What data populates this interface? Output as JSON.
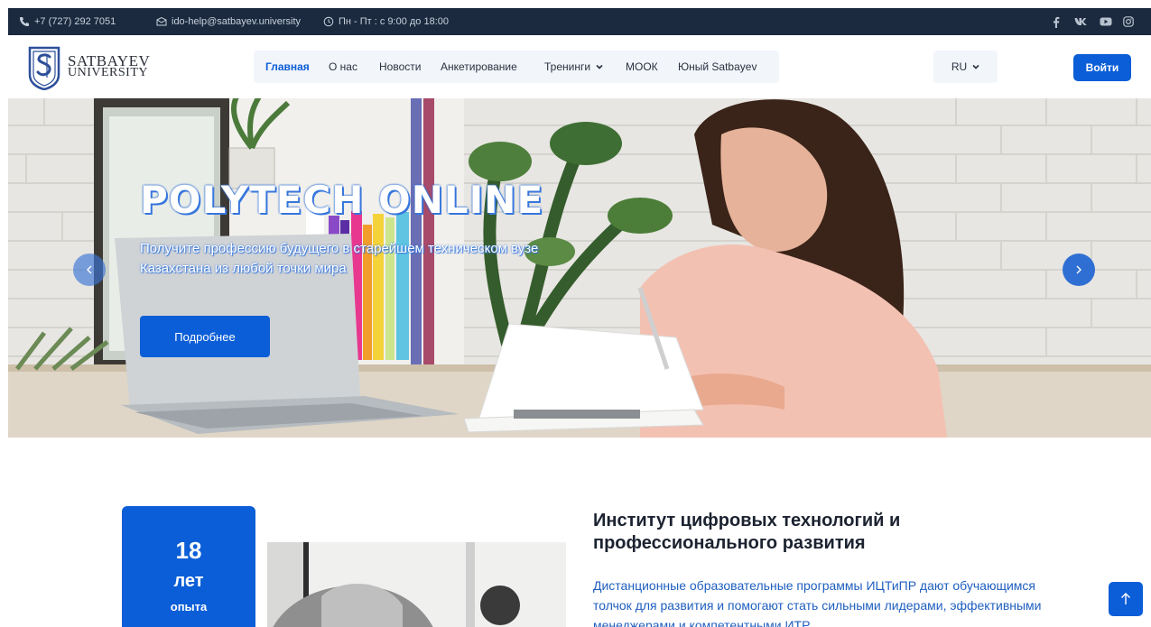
{
  "topbar": {
    "phone": "+7 (727) 292 7051",
    "email": "ido-help@satbayev.university",
    "hours": "Пн - Пт : с 9:00 до 18:00",
    "socials": [
      "facebook-icon",
      "vk-icon",
      "youtube-icon",
      "instagram-icon"
    ]
  },
  "logo": {
    "line1": "SATBAYEV",
    "line2": "UNIVERSITY"
  },
  "nav": {
    "items": [
      {
        "label": "Главная",
        "active": true
      },
      {
        "label": "О нас"
      },
      {
        "label": "Новости"
      },
      {
        "label": "Анкетирование"
      },
      {
        "label": "Тренинги",
        "dropdown": true
      },
      {
        "label": "МООК"
      },
      {
        "label": "Юный Satbayev"
      }
    ]
  },
  "lang": {
    "label": "RU"
  },
  "login": {
    "label": "Войти"
  },
  "hero": {
    "title": "POLYTECH ONLINE",
    "subtitle": "Получите профессию будущего в старейшем техническом вузе Казахстана из любой точки мира",
    "button": "Подробнее"
  },
  "stats": {
    "number": "18",
    "unit": "лет",
    "label": "опыта"
  },
  "about": {
    "title": "Институт цифровых технологий и профессионального развития",
    "text": "Дистанционные образовательные программы ИЦТиПР дают обучающимся толчок для развития и помогают стать сильными лидерами, эффективными менеджерами и компетентными ИТР."
  },
  "colors": {
    "primary": "#0b5ed7",
    "topbar": "#1b2a3f",
    "nav_bg": "#f2f5fa"
  }
}
